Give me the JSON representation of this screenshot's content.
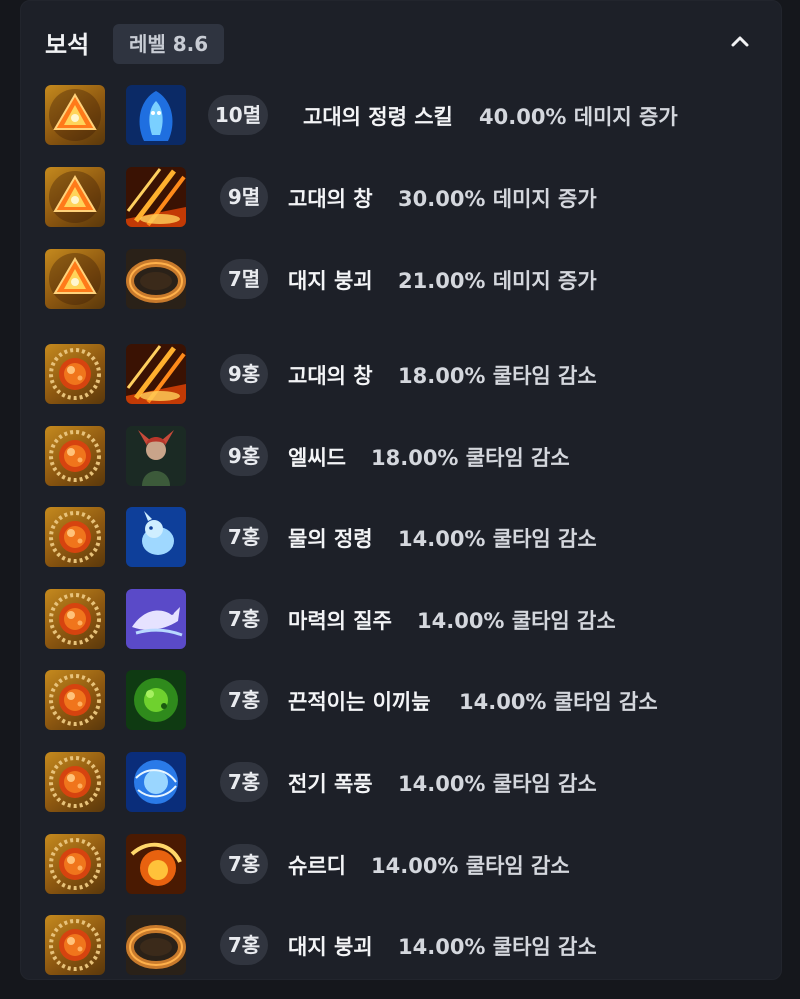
{
  "header": {
    "title": "보석",
    "level": "레벨 8.6",
    "collapse_icon": "chevron-up-icon"
  },
  "gems": [
    {
      "gem_type": "damage",
      "level": "10멸",
      "skill": "고대의 정령 스킬",
      "effect": "40.00% 데미지 증가",
      "skill_icon": "spirit-blue-icon"
    },
    {
      "gem_type": "damage",
      "level": "9멸",
      "skill": "고대의 창",
      "effect": "30.00% 데미지 증가",
      "skill_icon": "spear-orange-icon"
    },
    {
      "gem_type": "damage",
      "level": "7멸",
      "skill": "대지 붕괴",
      "effect": "21.00% 데미지 증가",
      "skill_icon": "earth-ring-icon"
    },
    {
      "gem_type": "cooldown",
      "level": "9홍",
      "skill": "고대의 창",
      "effect": "18.00% 쿨타임 감소",
      "skill_icon": "spear-orange-icon"
    },
    {
      "gem_type": "cooldown",
      "level": "9홍",
      "skill": "엘씨드",
      "effect": "18.00% 쿨타임 감소",
      "skill_icon": "elcid-portrait-icon"
    },
    {
      "gem_type": "cooldown",
      "level": "7홍",
      "skill": "물의 정령",
      "effect": "14.00% 쿨타임 감소",
      "skill_icon": "water-spirit-icon"
    },
    {
      "gem_type": "cooldown",
      "level": "7홍",
      "skill": "마력의 질주",
      "effect": "14.00% 쿨타임 감소",
      "skill_icon": "mana-horse-icon"
    },
    {
      "gem_type": "cooldown",
      "level": "7홍",
      "skill": "끈적이는 이끼늪",
      "effect": "14.00% 쿨타임 감소",
      "skill_icon": "moss-swamp-icon"
    },
    {
      "gem_type": "cooldown",
      "level": "7홍",
      "skill": "전기 폭풍",
      "effect": "14.00% 쿨타임 감소",
      "skill_icon": "electric-storm-icon"
    },
    {
      "gem_type": "cooldown",
      "level": "7홍",
      "skill": "슈르디",
      "effect": "14.00% 쿨타임 감소",
      "skill_icon": "shurdi-fire-icon"
    },
    {
      "gem_type": "cooldown",
      "level": "7홍",
      "skill": "대지 붕괴",
      "effect": "14.00% 쿨타임 감소",
      "skill_icon": "earth-ring-icon"
    }
  ],
  "colors": {
    "background": "#15171c",
    "panel": "#1d2028",
    "badge": "#31353f",
    "gem_gold": "#c58a1e",
    "text": "#f3f4f6",
    "effect_text": "#d4d7dd"
  }
}
